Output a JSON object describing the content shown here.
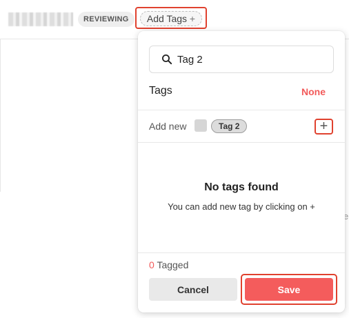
{
  "header": {
    "status_badge": "REVIEWING",
    "add_tags_label": "Add Tags",
    "add_tags_plus": "+"
  },
  "background": {
    "clipped_text": "e"
  },
  "popover": {
    "search": {
      "value": "Tag 2",
      "icon": "search-icon"
    },
    "tags_heading": "Tags",
    "none_label": "None",
    "add_new_label": "Add new",
    "new_tag_chip": "Tag 2",
    "add_button_label": "+",
    "empty_title": "No tags found",
    "empty_text": "You can add new tag by clicking on +",
    "tagged_count": "0",
    "tagged_label": "Tagged",
    "cancel_label": "Cancel",
    "save_label": "Save"
  },
  "colors": {
    "accent_red": "#f45c5c",
    "highlight_outline": "#e0412e",
    "swatch": "#d6d6d6"
  }
}
